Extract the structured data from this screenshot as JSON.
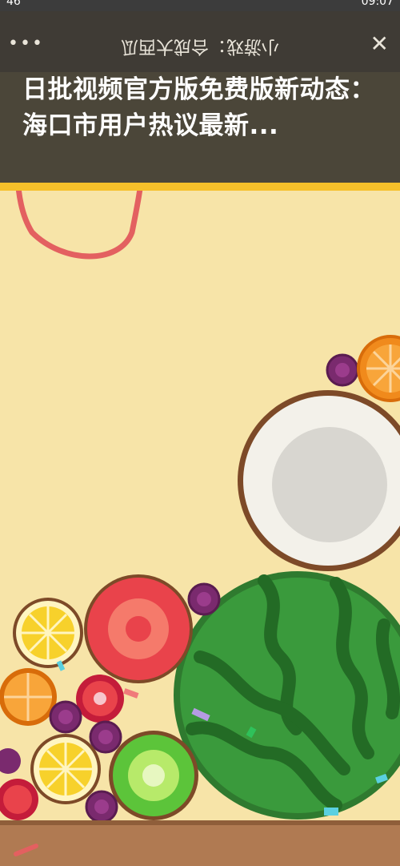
{
  "status_bar": {
    "left": "46",
    "right": "09:07"
  },
  "nav": {
    "more_label": "•••",
    "title": "小游戏：合成大西瓜",
    "close_label": "✕"
  },
  "banner": {
    "headline": "日批视频官方版免费版新动态：海口市用户热议最新..."
  },
  "game": {
    "fruits": [
      "grape",
      "orange",
      "coconut",
      "watermelon",
      "lemon",
      "tomato",
      "kiwi",
      "strawberry"
    ],
    "colors": {
      "background": "#f7e4a8",
      "ground": "#b07a52",
      "watermelon": "#3a9a3c",
      "coconut": "#f3f1ea",
      "tomato": "#e9434b",
      "kiwi": "#5cc43a",
      "orange": "#f08a1c",
      "lemon": "#f7d12b",
      "grape": "#7a2a6e"
    }
  }
}
